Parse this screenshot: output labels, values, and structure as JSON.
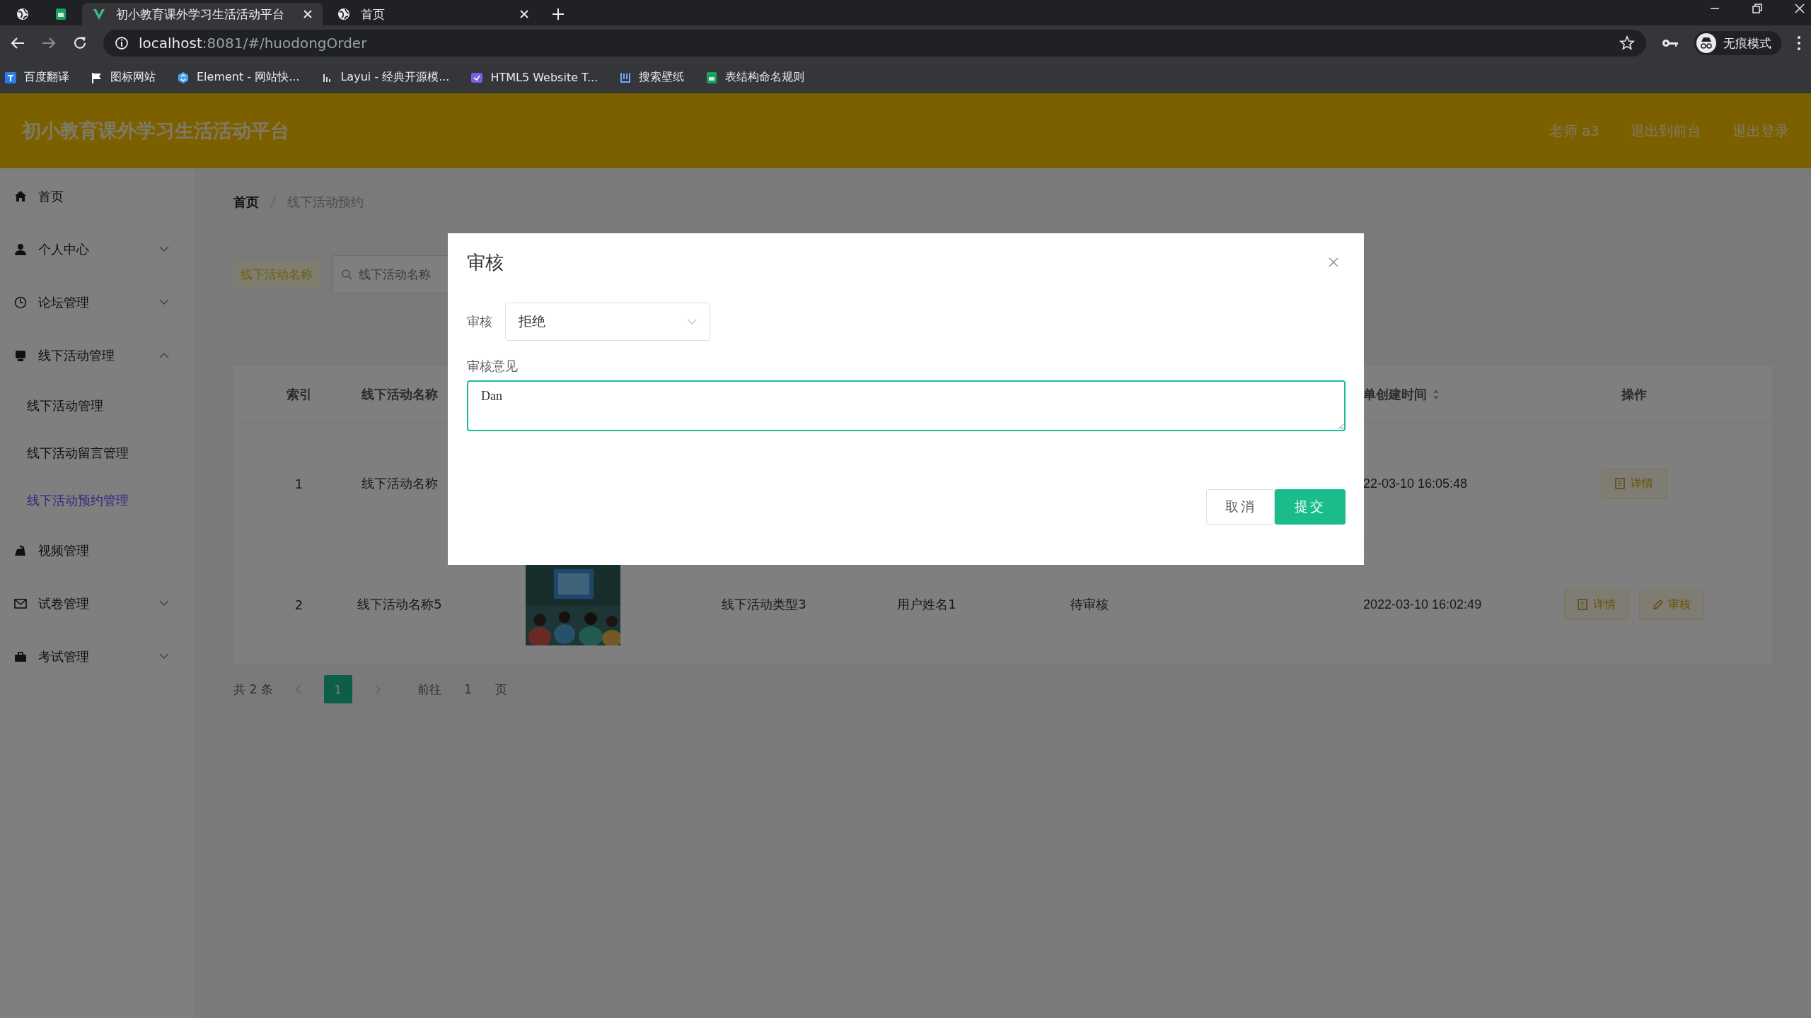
{
  "browser": {
    "tabs": [
      {
        "kind": "pinned",
        "selected": false
      },
      {
        "kind": "pinned",
        "selected": false
      },
      {
        "kind": "page",
        "title": "初小教育课外学习生活活动平台",
        "selected": true
      },
      {
        "kind": "page",
        "title": "首页",
        "selected": false
      }
    ],
    "address": {
      "host": "localhost",
      "rest": ":8081/#/huodongOrder"
    },
    "bookmarks": [
      {
        "label": "百度翻译"
      },
      {
        "label": "图标网站"
      },
      {
        "label": "Element - 网站快..."
      },
      {
        "label": "Layui - 经典开源模..."
      },
      {
        "label": "HTML5 Website T..."
      },
      {
        "label": "搜索壁纸"
      },
      {
        "label": "表结构命名规则"
      }
    ],
    "profile": "无痕模式"
  },
  "app": {
    "title": "初小教育课外学习生活活动平台",
    "user_links": [
      "老师 a3",
      "退出到前台",
      "退出登录"
    ]
  },
  "sidebar": {
    "items": [
      {
        "label": "首页",
        "kind": "link",
        "selected": false
      },
      {
        "label": "个人中心",
        "kind": "menu",
        "expanded": false
      },
      {
        "label": "论坛管理",
        "kind": "menu",
        "expanded": false
      },
      {
        "label": "线下活动管理",
        "kind": "menu",
        "expanded": true,
        "children": [
          {
            "label": "线下活动管理",
            "selected": false
          },
          {
            "label": "线下活动留言管理",
            "selected": false
          },
          {
            "label": "线下活动预约管理",
            "selected": true
          }
        ]
      },
      {
        "label": "视频管理",
        "kind": "link",
        "selected": false
      },
      {
        "label": "试卷管理",
        "kind": "menu",
        "expanded": false
      },
      {
        "label": "考试管理",
        "kind": "menu",
        "expanded": false
      }
    ]
  },
  "breadcrumb": [
    "首页",
    "线下活动预约"
  ],
  "search": {
    "label": "线下活动名称",
    "placeholder": "线下活动名称"
  },
  "table": {
    "columns": {
      "index": "索引",
      "name": "线下活动名称",
      "created": "单创建时间",
      "actions": "操作"
    },
    "rows": [
      {
        "index": "1",
        "name": "线下活动名称",
        "created": "22-03-10 16:05:48",
        "actions": [
          {
            "label": "详情",
            "kind": "detail"
          }
        ]
      },
      {
        "index": "2",
        "name": "线下活动名称5",
        "image": {
          "kind": "picture"
        },
        "type": "线下活动类型3",
        "user": "用户姓名1",
        "status": "待审核",
        "created": "2022-03-10 16:02:49",
        "actions": [
          {
            "label": "详情",
            "kind": "detail"
          },
          {
            "label": "审核",
            "kind": "review"
          }
        ]
      }
    ]
  },
  "pagination": {
    "total": "共 2 条",
    "pages": [
      {
        "label": "1",
        "selected": true
      }
    ],
    "goto_label": "前往",
    "goto_value": "1",
    "page_unit": "页"
  },
  "dialog": {
    "title": "审核",
    "status_label": "审核",
    "status_value": "拒绝",
    "comment_label": "审核意见",
    "comment_value": "Dan",
    "buttons": [
      {
        "label": "取消",
        "kind": "default"
      },
      {
        "label": "提交",
        "kind": "primary"
      }
    ]
  }
}
